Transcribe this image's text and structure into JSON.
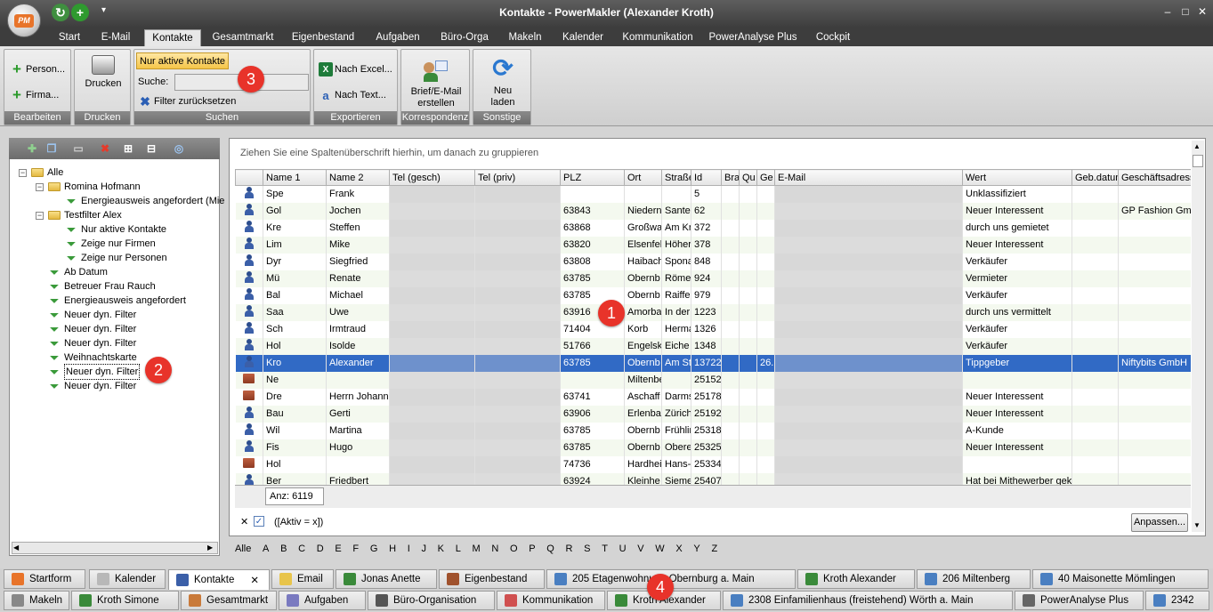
{
  "window": {
    "title": "Kontakte - PowerMakler (Alexander Kroth)",
    "logo": "PM"
  },
  "ribbon_tabs": [
    "Start",
    "E-Mail",
    "Kontakte",
    "Gesamtmarkt",
    "Eigenbestand",
    "Aufgaben",
    "Büro-Orga",
    "Makeln",
    "Kalender",
    "Kommunikation",
    "PowerAnalyse Plus",
    "Cockpit"
  ],
  "active_tab": "Kontakte",
  "ribbon": {
    "bearbeiten": {
      "label": "Bearbeiten",
      "person": "Person...",
      "firma": "Firma..."
    },
    "drucken": {
      "label": "Drucken",
      "button": "Drucken"
    },
    "suchen": {
      "label": "Suchen",
      "active_filter": "Nur aktive Kontakte",
      "search_label": "Suche:",
      "search_value": "",
      "reset": "Filter zurücksetzen"
    },
    "exportieren": {
      "label": "Exportieren",
      "excel": "Nach Excel...",
      "text": "Nach Text..."
    },
    "korrespondenz": {
      "label": "Korrespondenz",
      "brief_line1": "Brief/E-Mail",
      "brief_line2": "erstellen"
    },
    "sonstige": {
      "label": "Sonstige",
      "reload_line1": "Neu",
      "reload_line2": "laden"
    }
  },
  "tree": {
    "root": "Alle",
    "nodes": [
      {
        "label": "Romina  Hofmann"
      },
      {
        "label": "Energieausweis angefordert (Mie"
      },
      {
        "label": "Testfilter Alex"
      },
      {
        "label": "Nur aktive Kontakte"
      },
      {
        "label": "Zeige nur Firmen"
      },
      {
        "label": "Zeige nur Personen"
      },
      {
        "label": "Ab Datum"
      },
      {
        "label": "Betreuer Frau Rauch"
      },
      {
        "label": "Energieausweis angefordert"
      },
      {
        "label": "Neuer dyn. Filter"
      },
      {
        "label": "Neuer dyn. Filter"
      },
      {
        "label": "Neuer dyn. Filter"
      },
      {
        "label": "Weihnachtskarte"
      },
      {
        "label": "Neuer dyn. Filter"
      },
      {
        "label": "Neuer dyn. Filter"
      }
    ]
  },
  "grid": {
    "group_hint": "Ziehen Sie eine Spaltenüberschrift hierhin, um danach zu gruppieren",
    "columns": [
      "Name 1",
      "Name 2",
      "Tel (gesch)",
      "Tel (priv)",
      "PLZ",
      "Ort",
      "Straße",
      "Id",
      "Bra",
      "Qu",
      "Ge",
      "E-Mail",
      "Wert",
      "Geb.datum",
      "Geschäftsadress"
    ],
    "rows": [
      {
        "type": "person",
        "n1": "Spe",
        "n2": "Frank",
        "plz": "",
        "ort": "",
        "str": "",
        "id": "5",
        "ge": "",
        "wert": "Unklassifiziert",
        "adr": ""
      },
      {
        "type": "person",
        "n1": "Gol",
        "n2": "Jochen",
        "plz": "63843",
        "ort": "Niedern",
        "str": "Sante",
        "id": "62",
        "ge": "",
        "wert": "Neuer Interessent",
        "adr": "GP Fashion Gmb"
      },
      {
        "type": "person",
        "n1": "Kre",
        "n2": "Steffen",
        "plz": "63868",
        "ort": "Großwa",
        "str": "Am Kr",
        "id": "372",
        "ge": "",
        "wert": "durch uns gemietet",
        "adr": ""
      },
      {
        "type": "person",
        "n1": "Lim",
        "n2": "Mike",
        "plz": "63820",
        "ort": "Elsenfel",
        "str": "Höher",
        "id": "378",
        "ge": "",
        "wert": "Neuer Interessent",
        "adr": ""
      },
      {
        "type": "person",
        "n1": "Dyr",
        "n2": "Siegfried",
        "plz": "63808",
        "ort": "Haibach",
        "str": "Spona",
        "id": "848",
        "ge": "",
        "wert": "Verkäufer",
        "adr": ""
      },
      {
        "type": "person",
        "n1": "Mü",
        "n2": "Renate",
        "plz": "63785",
        "ort": "Obernb",
        "str": "Röme",
        "id": "924",
        "ge": "",
        "wert": "Vermieter",
        "adr": ""
      },
      {
        "type": "person",
        "n1": "Bal",
        "n2": "Michael",
        "plz": "63785",
        "ort": "Obernb",
        "str": "Raiffe",
        "id": "979",
        "ge": "",
        "wert": "Verkäufer",
        "adr": ""
      },
      {
        "type": "person",
        "n1": "Saa",
        "n2": "Uwe",
        "plz": "63916",
        "ort": "Amorba",
        "str": "In der",
        "id": "1223",
        "ge": "",
        "wert": "durch uns vermittelt",
        "adr": ""
      },
      {
        "type": "person",
        "n1": "Sch",
        "n2": "Irmtraud",
        "plz": "71404",
        "ort": "Korb",
        "str": "Herma",
        "id": "1326",
        "ge": "",
        "wert": "Verkäufer",
        "adr": ""
      },
      {
        "type": "person",
        "n1": "Hol",
        "n2": "Isolde",
        "plz": "51766",
        "ort": "Engelsk",
        "str": "Eiche",
        "id": "1348",
        "ge": "",
        "wert": "Verkäufer",
        "adr": ""
      },
      {
        "type": "person",
        "n1": "Kro",
        "n2": "Alexander",
        "plz": "63785",
        "ort": "Obernb",
        "str": "Am St",
        "id": "13722",
        "ge": "26.",
        "wert": "Tippgeber",
        "adr": "Niftybits GmbH",
        "selected": true
      },
      {
        "type": "company",
        "n1": "Ne",
        "n2": "",
        "plz": "",
        "ort": "Miltenbe",
        "str": "",
        "id": "25152",
        "ge": "",
        "wert": "",
        "adr": ""
      },
      {
        "type": "company",
        "n1": "Dre",
        "n2": "Herrn Johanne",
        "plz": "63741",
        "ort": "Aschaff",
        "str": "Darms",
        "id": "25178",
        "ge": "",
        "wert": "Neuer Interessent",
        "adr": ""
      },
      {
        "type": "person",
        "n1": "Bau",
        "n2": "Gerti",
        "plz": "63906",
        "ort": "Erlenba",
        "str": "Zürich",
        "id": "25192",
        "ge": "",
        "wert": "Neuer Interessent",
        "adr": ""
      },
      {
        "type": "person",
        "n1": "Wil",
        "n2": "Martina",
        "plz": "63785",
        "ort": "Obernb",
        "str": "Frühlir",
        "id": "25318",
        "ge": "",
        "wert": "A-Kunde",
        "adr": ""
      },
      {
        "type": "person",
        "n1": "Fis",
        "n2": "Hugo",
        "plz": "63785",
        "ort": "Obernb",
        "str": "Obere",
        "id": "25325",
        "ge": "",
        "wert": "Neuer Interessent",
        "adr": ""
      },
      {
        "type": "company",
        "n1": "Hol",
        "n2": "",
        "plz": "74736",
        "ort": "Hardhei",
        "str": "Hans-",
        "id": "25334",
        "ge": "",
        "wert": "",
        "adr": ""
      },
      {
        "type": "person",
        "n1": "Ber",
        "n2": "Friedbert",
        "plz": "63924",
        "ort": "Kleinhe",
        "str": "Sieme",
        "id": "25407",
        "ge": "",
        "wert": "Hat bei Mithewerber gek",
        "adr": ""
      }
    ],
    "count": "Anz: 6119",
    "filter_expr": "([Aktiv = x])",
    "customize": "Anpassen...",
    "alphabet": [
      "Alle",
      "A",
      "B",
      "C",
      "D",
      "E",
      "F",
      "G",
      "H",
      "I",
      "J",
      "K",
      "L",
      "M",
      "N",
      "O",
      "P",
      "Q",
      "R",
      "S",
      "T",
      "U",
      "V",
      "W",
      "X",
      "Y",
      "Z"
    ]
  },
  "taskbar_row1": [
    {
      "label": "Startform",
      "icon": "pm-icon"
    },
    {
      "label": "Kalender",
      "icon": "calendar-icon"
    },
    {
      "label": "Kontakte",
      "icon": "contacts-icon",
      "active": true
    },
    {
      "label": "Email",
      "icon": "email-icon"
    },
    {
      "label": "Jonas Anette",
      "icon": "person-icon"
    },
    {
      "label": "Eigenbestand",
      "icon": "house-icon"
    },
    {
      "label": "205  Etagenwohnung  Obernburg a. Main",
      "icon": "property-icon"
    },
    {
      "label": "Kroth Alexander",
      "icon": "person-icon"
    },
    {
      "label": "206  Miltenberg",
      "icon": "property-icon"
    },
    {
      "label": "40  Maisonette  Mömlingen",
      "icon": "property-icon"
    }
  ],
  "taskbar_row2": [
    {
      "label": "Makeln",
      "icon": "makeln-icon"
    },
    {
      "label": "Kroth Simone",
      "icon": "person-icon"
    },
    {
      "label": "Gesamtmarkt",
      "icon": "market-icon"
    },
    {
      "label": "Aufgaben",
      "icon": "tasks-icon"
    },
    {
      "label": "Büro-Organisation",
      "icon": "office-icon"
    },
    {
      "label": "Kommunikation",
      "icon": "communication-icon"
    },
    {
      "label": "Kroth Alexander",
      "icon": "person-icon"
    },
    {
      "label": "2308  Einfamilienhaus (freistehend)  Wörth a. Main",
      "icon": "property-icon"
    },
    {
      "label": "PowerAnalyse Plus",
      "icon": "analysis-icon"
    },
    {
      "label": "2342",
      "icon": "property-icon"
    }
  ],
  "badges": [
    "1",
    "2",
    "3",
    "4"
  ]
}
